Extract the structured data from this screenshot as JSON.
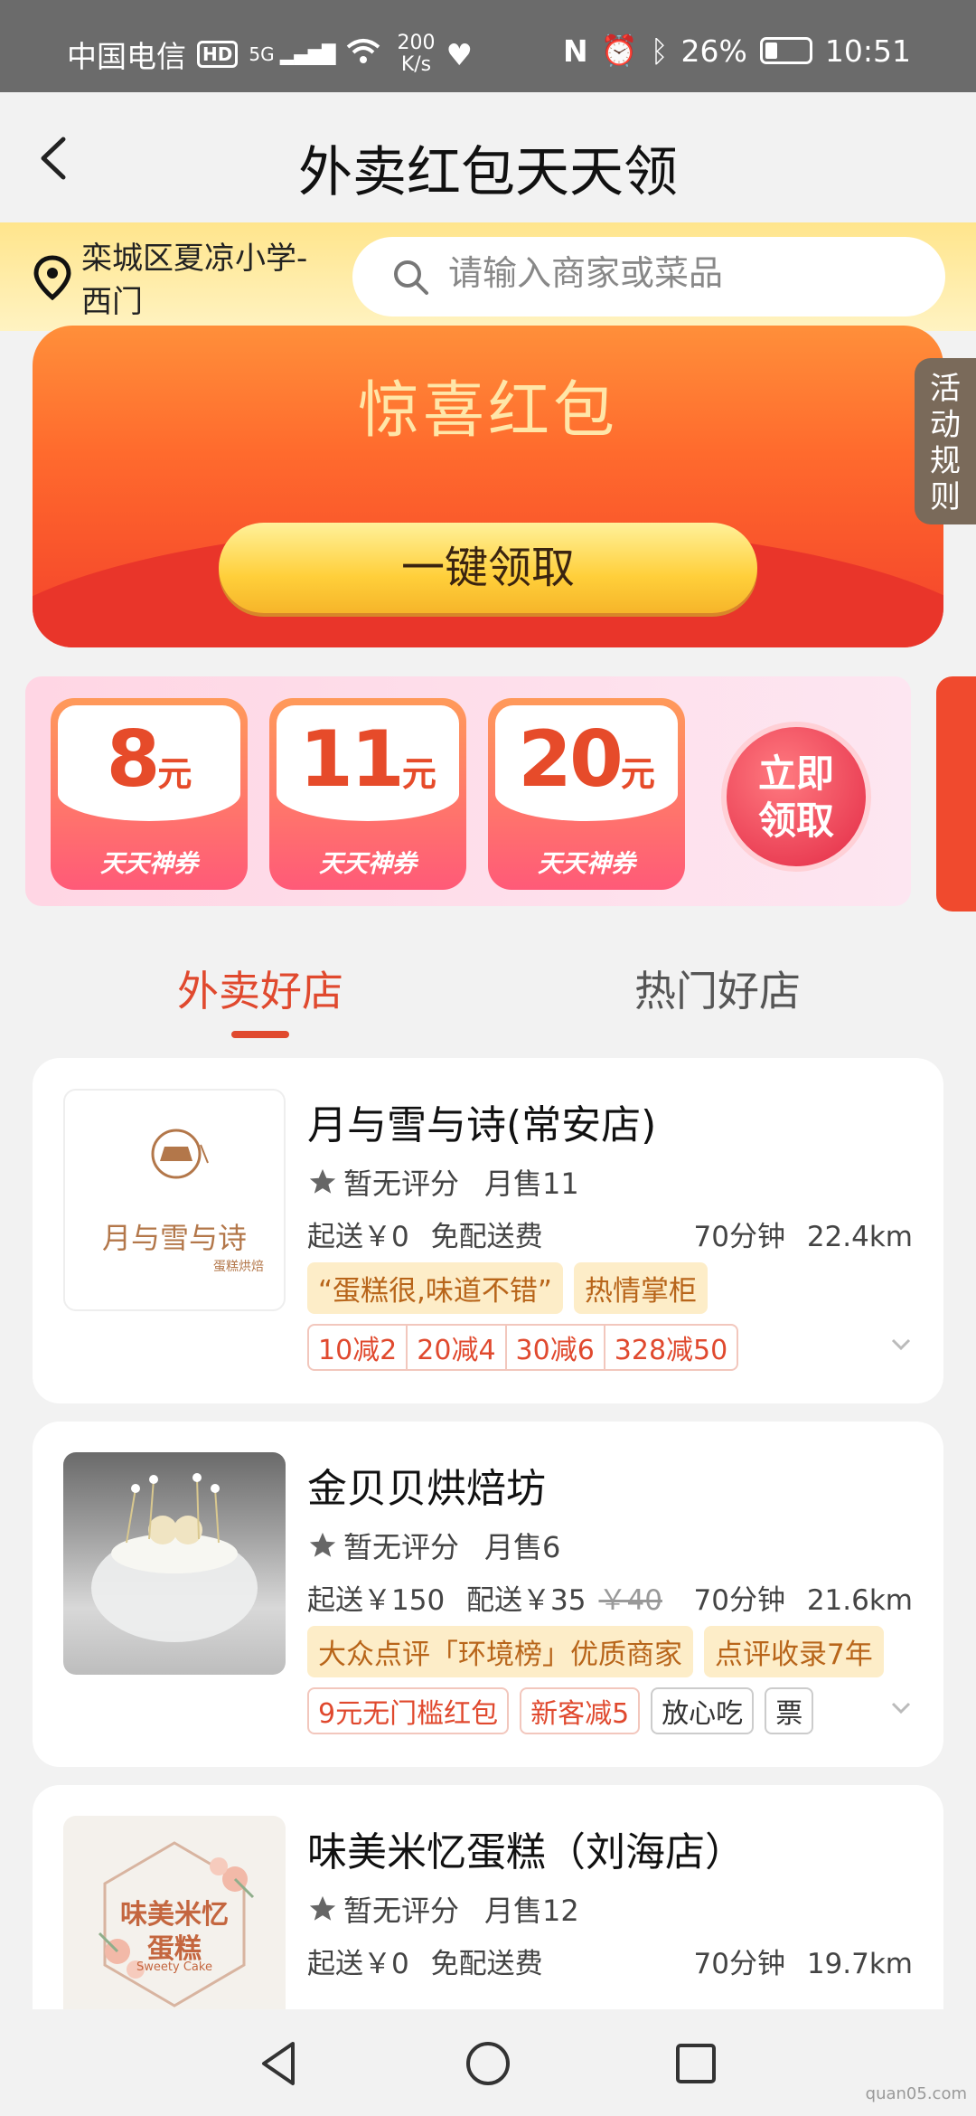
{
  "status_bar": {
    "carrier": "中国电信",
    "hd": "HD",
    "signal": "5G",
    "speed_value": "200",
    "speed_unit": "K/s",
    "battery": "26%",
    "time": "10:51"
  },
  "header": {
    "title": "外卖红包天天领"
  },
  "location": {
    "address": "栾城区夏凉小学-西门"
  },
  "search": {
    "placeholder": "请输入商家或菜品"
  },
  "banner": {
    "title": "惊喜红包",
    "button": "一键领取"
  },
  "rules_tab": "活动规则",
  "coupons": {
    "items": [
      {
        "value": "8",
        "unit": "元",
        "label": "天天神券"
      },
      {
        "value": "11",
        "unit": "元",
        "label": "天天神券"
      },
      {
        "value": "20",
        "unit": "元",
        "label": "天天神券"
      }
    ],
    "claim_line1": "立即",
    "claim_line2": "领取"
  },
  "tabs": {
    "active": "外卖好店",
    "inactive": "热门好店"
  },
  "stores": [
    {
      "name": "月与雪与诗(常安店)",
      "logo_text": "月与雪与诗",
      "logo_sub": "蛋糕烘焙",
      "rating": "暂无评分",
      "monthly": "月售11",
      "min_order": "起送￥0",
      "delivery_fee": "免配送费",
      "time": "70分钟",
      "distance": "22.4km",
      "tags": [
        "“蛋糕很,味道不错”",
        "热情掌柜"
      ],
      "promos": [
        "10减2",
        "20减4",
        "30减6",
        "328减50"
      ]
    },
    {
      "name": "金贝贝烘焙坊",
      "rating": "暂无评分",
      "monthly": "月售6",
      "min_order": "起送￥150",
      "delivery_fee": "配送￥35",
      "delivery_fee_old": "￥40",
      "time": "70分钟",
      "distance": "21.6km",
      "tags": [
        "大众点评「环境榜」优质商家",
        "点评收录7年"
      ],
      "promos": [
        "9元无门槛红包",
        "新客减5",
        "放心吃",
        "票"
      ]
    },
    {
      "name": "味美米忆蛋糕（刘海店）",
      "logo_line1": "味美米忆",
      "logo_line2": "蛋糕",
      "logo_sub": "Sweety Cake",
      "rating": "暂无评分",
      "monthly": "月售12",
      "min_order": "起送￥0",
      "delivery_fee": "免配送费",
      "time": "70分钟",
      "distance": "19.7km"
    }
  ],
  "watermark": "quan05.com",
  "colors": {
    "accent": "#e0492e",
    "banner": "#f3402b",
    "tag_bg": "#fdedc8"
  }
}
